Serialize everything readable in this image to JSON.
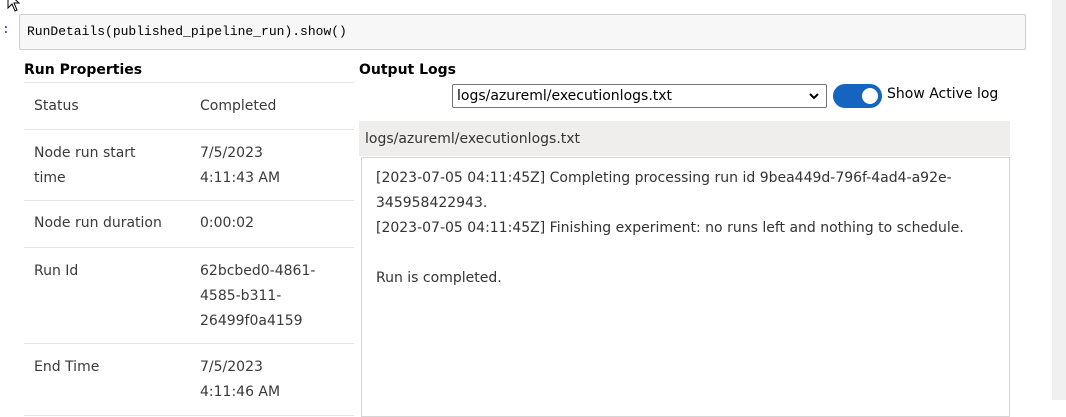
{
  "cell": {
    "prompt": ":",
    "code": "RunDetails(published_pipeline_run).show()"
  },
  "run_properties": {
    "title": "Run Properties",
    "rows": [
      {
        "label": "Status",
        "value": "Completed"
      },
      {
        "label": "Node run start time",
        "value": "7/5/2023 4:11:43 AM"
      },
      {
        "label": "Node run duration",
        "value": "0:00:02"
      },
      {
        "label": "Run Id",
        "value": "62bcbed0-4861-4585-b311-26499f0a4159"
      },
      {
        "label": "End Time",
        "value": "7/5/2023 4:11:46 AM"
      }
    ]
  },
  "output_logs": {
    "title": "Output Logs",
    "selected_log": "logs/azureml/executionlogs.txt",
    "toggle_label": "Show Active log",
    "toggle_on": true,
    "log_header": "logs/azureml/executionlogs.txt",
    "lines": [
      "[2023-07-05 04:11:45Z] Completing processing run id 9bea449d-796f-4ad4-a92e-345958422943.",
      "[2023-07-05 04:11:45Z] Finishing experiment: no runs left and nothing to schedule.",
      "",
      "Run is completed."
    ]
  },
  "colors": {
    "toggle_accent": "#1565c0",
    "code_background": "#f7f7f7",
    "log_header_background": "#f0eded"
  },
  "icons": {
    "cursor": "mouse-pointer-icon",
    "select": "chevron-down-icon"
  }
}
